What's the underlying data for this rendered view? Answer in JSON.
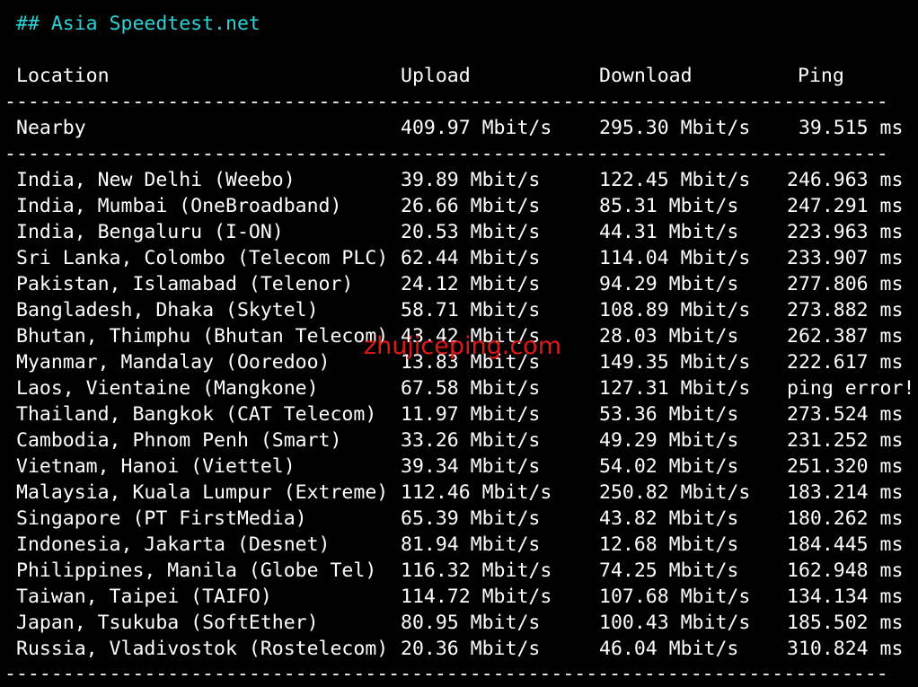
{
  "heading": "## Asia Speedtest.net",
  "columns": {
    "location": "Location",
    "upload": "Upload",
    "download": "Download",
    "ping": "Ping"
  },
  "separator": "----------------------------------------------------------------------------------------------------",
  "nearby": {
    "location": "Nearby",
    "upload": "409.97 Mbit/s",
    "download": "295.30 Mbit/s",
    "ping": " 39.515 ms"
  },
  "rows": [
    {
      "location": "India, New Delhi (Weebo)",
      "upload": "39.89 Mbit/s",
      "download": "122.45 Mbit/s",
      "ping": "246.963 ms"
    },
    {
      "location": "India, Mumbai (OneBroadband)",
      "upload": "26.66 Mbit/s",
      "download": "85.31 Mbit/s",
      "ping": "247.291 ms"
    },
    {
      "location": "India, Bengaluru (I-ON)",
      "upload": "20.53 Mbit/s",
      "download": "44.31 Mbit/s",
      "ping": "223.963 ms"
    },
    {
      "location": "Sri Lanka, Colombo (Telecom PLC)",
      "upload": "62.44 Mbit/s",
      "download": "114.04 Mbit/s",
      "ping": "233.907 ms"
    },
    {
      "location": "Pakistan, Islamabad (Telenor)",
      "upload": "24.12 Mbit/s",
      "download": "94.29 Mbit/s",
      "ping": "277.806 ms"
    },
    {
      "location": "Bangladesh, Dhaka (Skytel)",
      "upload": "58.71 Mbit/s",
      "download": "108.89 Mbit/s",
      "ping": "273.882 ms"
    },
    {
      "location": "Bhutan, Thimphu (Bhutan Telecom)",
      "upload": "43.42 Mbit/s",
      "download": "28.03 Mbit/s",
      "ping": "262.387 ms"
    },
    {
      "location": "Myanmar, Mandalay (Ooredoo)",
      "upload": "13.83 Mbit/s",
      "download": "149.35 Mbit/s",
      "ping": "222.617 ms"
    },
    {
      "location": "Laos, Vientaine (Mangkone)",
      "upload": "67.58 Mbit/s",
      "download": "127.31 Mbit/s",
      "ping": "ping error!"
    },
    {
      "location": "Thailand, Bangkok (CAT Telecom)",
      "upload": "11.97 Mbit/s",
      "download": "53.36 Mbit/s",
      "ping": "273.524 ms"
    },
    {
      "location": "Cambodia, Phnom Penh (Smart)",
      "upload": "33.26 Mbit/s",
      "download": "49.29 Mbit/s",
      "ping": "231.252 ms"
    },
    {
      "location": "Vietnam, Hanoi (Viettel)",
      "upload": "39.34 Mbit/s",
      "download": "54.02 Mbit/s",
      "ping": "251.320 ms"
    },
    {
      "location": "Malaysia, Kuala Lumpur (Extreme)",
      "upload": "112.46 Mbit/s",
      "download": "250.82 Mbit/s",
      "ping": "183.214 ms"
    },
    {
      "location": "Singapore (PT FirstMedia)",
      "upload": "65.39 Mbit/s",
      "download": "43.82 Mbit/s",
      "ping": "180.262 ms"
    },
    {
      "location": "Indonesia, Jakarta (Desnet)",
      "upload": "81.94 Mbit/s",
      "download": "12.68 Mbit/s",
      "ping": "184.445 ms"
    },
    {
      "location": "Philippines, Manila (Globe Tel)",
      "upload": "116.32 Mbit/s",
      "download": "74.25 Mbit/s",
      "ping": "162.948 ms"
    },
    {
      "location": "Taiwan, Taipei (TAIFO)",
      "upload": "114.72 Mbit/s",
      "download": "107.68 Mbit/s",
      "ping": "134.134 ms"
    },
    {
      "location": "Japan, Tsukuba (SoftEther)",
      "upload": "80.95 Mbit/s",
      "download": "100.43 Mbit/s",
      "ping": "185.502 ms"
    },
    {
      "location": "Russia, Vladivostok (Rostelecom)",
      "upload": "20.36 Mbit/s",
      "download": "46.04 Mbit/s",
      "ping": "310.824 ms"
    }
  ],
  "watermark": "zhujiceping.com",
  "colors": {
    "background": "#000000",
    "text": "#ffffff",
    "heading": "#29d3d8",
    "watermark": "#e01818"
  }
}
